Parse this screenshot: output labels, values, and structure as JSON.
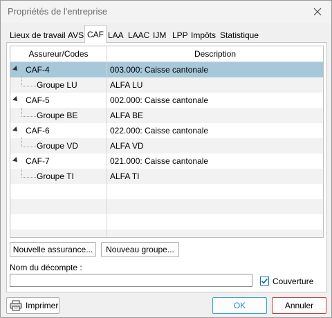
{
  "window": {
    "title": "Propriétés de l'entreprise"
  },
  "tabs": [
    {
      "label": "Lieux de travail"
    },
    {
      "label": "AVS"
    },
    {
      "label": "CAF",
      "active": true
    },
    {
      "label": "LAA"
    },
    {
      "label": "LAAC"
    },
    {
      "label": "IJM"
    },
    {
      "label": "LPP"
    },
    {
      "label": "Impôts"
    },
    {
      "label": "Statistique"
    }
  ],
  "grid": {
    "columns": [
      "Assureur/Codes",
      "Description"
    ],
    "rows": [
      {
        "code": "CAF-4",
        "description": "003.000: Caisse cantonale",
        "level": 0,
        "selected": true
      },
      {
        "code": "Groupe LU",
        "description": "ALFA LU",
        "level": 1
      },
      {
        "code": "CAF-5",
        "description": "002.000: Caisse cantonale",
        "level": 0
      },
      {
        "code": "Groupe BE",
        "description": "ALFA BE",
        "level": 1
      },
      {
        "code": "CAF-6",
        "description": "022.000: Caisse cantonale",
        "level": 0
      },
      {
        "code": "Groupe VD",
        "description": "ALFA VD",
        "level": 1
      },
      {
        "code": "CAF-7",
        "description": "021.000: Caisse cantonale",
        "level": 0
      },
      {
        "code": "Groupe TI",
        "description": "ALFA TI",
        "level": 1
      }
    ]
  },
  "buttons": {
    "new_insurance": "Nouvelle assurance...",
    "new_group": "Nouveau groupe..."
  },
  "settlement": {
    "label": "Nom du décompte :",
    "value": "",
    "coverage_label": "Couverture",
    "coverage_checked": true
  },
  "footer": {
    "print": "Imprimer",
    "ok": "OK",
    "cancel": "Annuler"
  },
  "colors": {
    "selection": "#a6c8d8",
    "ok_border": "#36a5c9",
    "cancel_border": "#c83c3c",
    "checkbox": "#0f6ab4"
  }
}
